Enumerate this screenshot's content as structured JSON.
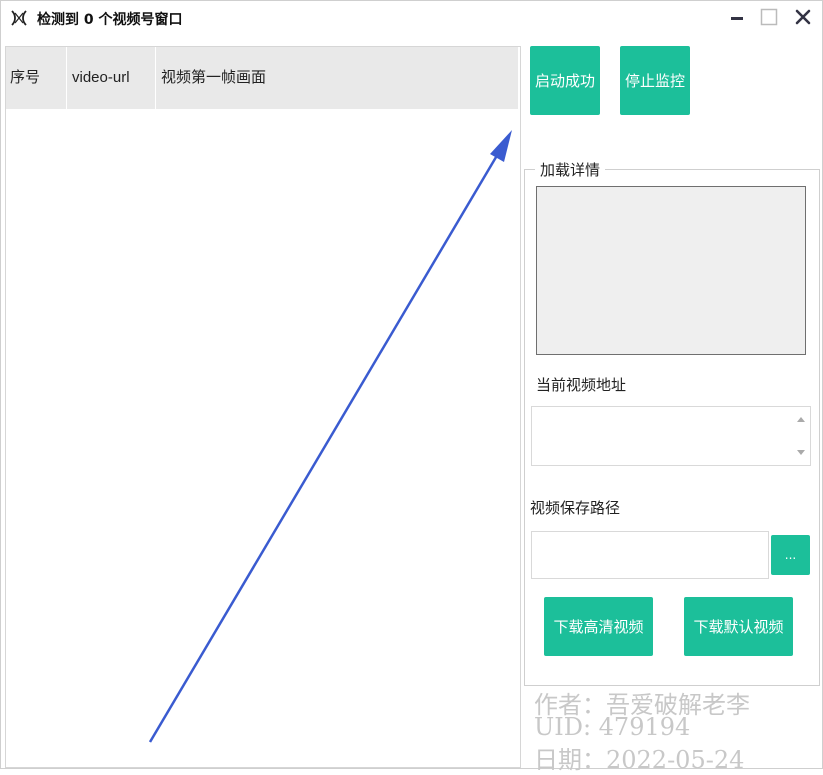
{
  "window": {
    "title": "检测到 0 个视频号窗口",
    "app_icon": "scissors-logo-icon",
    "controls": {
      "minimize": "minimize-icon",
      "maximize": "maximize-icon",
      "close": "close-icon"
    }
  },
  "table": {
    "columns": [
      "序号",
      "video-url",
      "视频第一帧画面"
    ],
    "rows": []
  },
  "buttons": {
    "start": "启动成功",
    "stop": "停止监控",
    "browse": "...",
    "download_hd": "下载高清视频",
    "download_default": "下载默认视频"
  },
  "panel": {
    "group_title": "加载详情",
    "current_url_label": "当前视频地址",
    "current_url_value": "",
    "save_path_label": "视频保存路径",
    "save_path_value": ""
  },
  "watermark": {
    "author": "作者：吾爱破解老李",
    "uid": "UID: 479194",
    "date": "日期：2022-05-24"
  },
  "colors": {
    "accent": "#1cbf9a",
    "arrow": "#3a5bd0",
    "header_bg": "#e9e9e9",
    "watermark": "#c8c8c8"
  }
}
